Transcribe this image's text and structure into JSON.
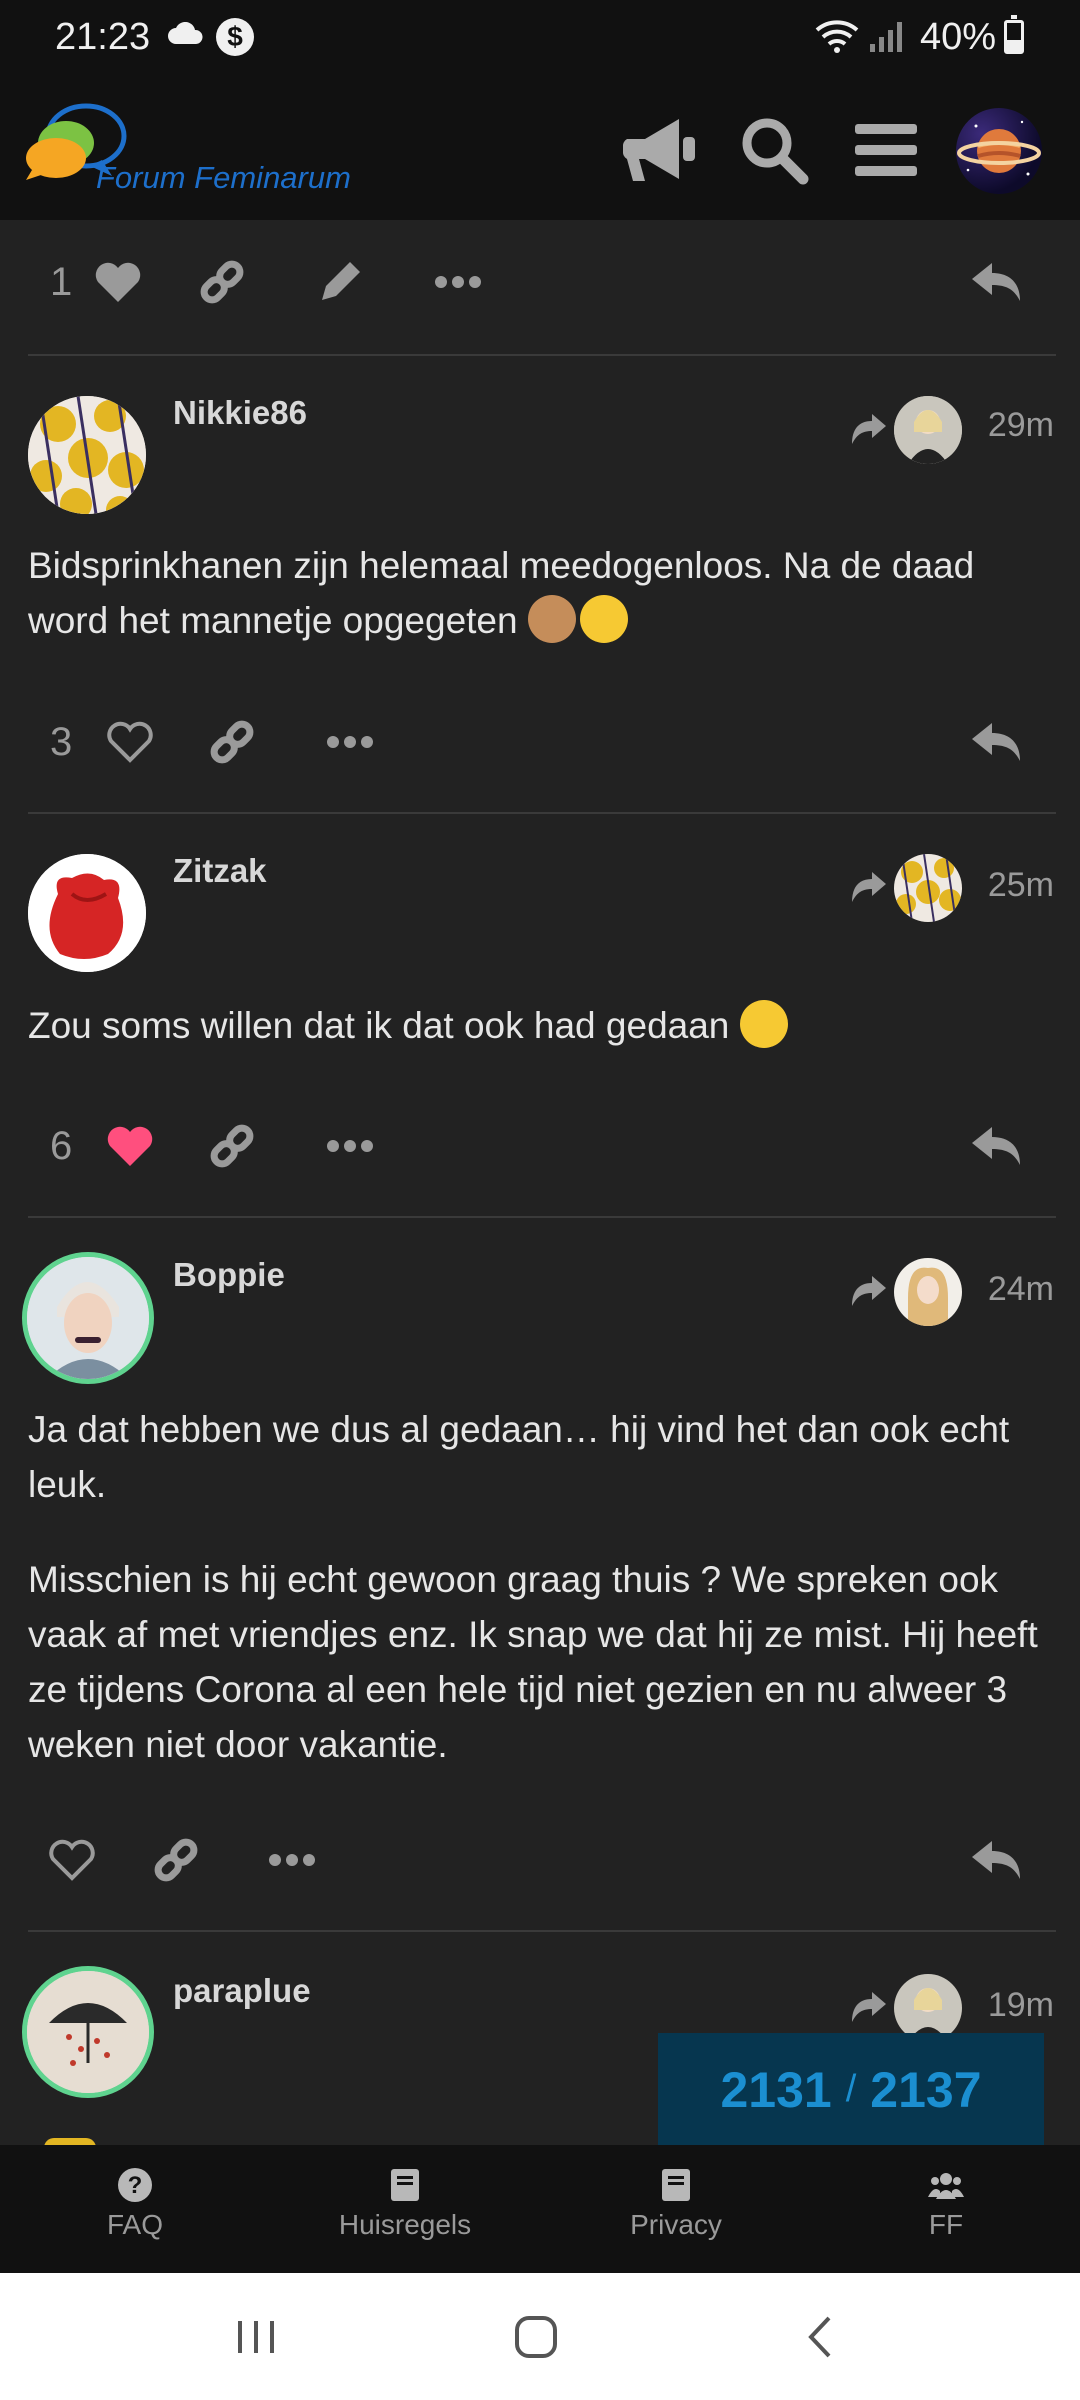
{
  "status_bar": {
    "time": "21:23",
    "battery": "40%",
    "battery_level": 0.4
  },
  "app": {
    "name": "Forum Feminarum"
  },
  "first_actions": {
    "like_count": "1"
  },
  "posts": [
    {
      "username": "Nikkie86",
      "time": "29m",
      "paragraphs": [
        "Bidsprinkhanen zijn helemaal meedogenloos. Na de daad word het mannetje opgegeten"
      ],
      "like_count": "3",
      "liked": false
    },
    {
      "username": "Zitzak",
      "time": "25m",
      "paragraphs": [
        "Zou soms willen dat ik dat ook had gedaan"
      ],
      "like_count": "6",
      "liked": true
    },
    {
      "username": "Boppie",
      "time": "24m",
      "paragraphs": [
        "Ja dat hebben we dus al gedaan… hij vind het dan ook echt leuk.",
        "Misschien is hij echt gewoon graag thuis ? We spreken ook vaak af met vriendjes enz. Ik snap we dat hij ze mist. Hij heeft ze tijdens Corona al een hele tijd niet gezien en nu alweer 3 weken niet door vakantie."
      ],
      "like_count": "",
      "liked": false
    },
    {
      "username": "paraplue",
      "time": "19m"
    }
  ],
  "progress": {
    "current": "2131",
    "separator": "/",
    "total": "2137"
  },
  "footer": [
    {
      "label": "FAQ",
      "icon": "question-circle-icon"
    },
    {
      "label": "Huisregels",
      "icon": "book-icon"
    },
    {
      "label": "Privacy",
      "icon": "book-icon"
    },
    {
      "label": "FF",
      "icon": "users-icon"
    }
  ],
  "colors": {
    "accent_heart": "#ff4f7e",
    "progress_bg": "#06364f",
    "progress_text": "#1b8fd1",
    "avatar_ring": "#5fd38f"
  }
}
